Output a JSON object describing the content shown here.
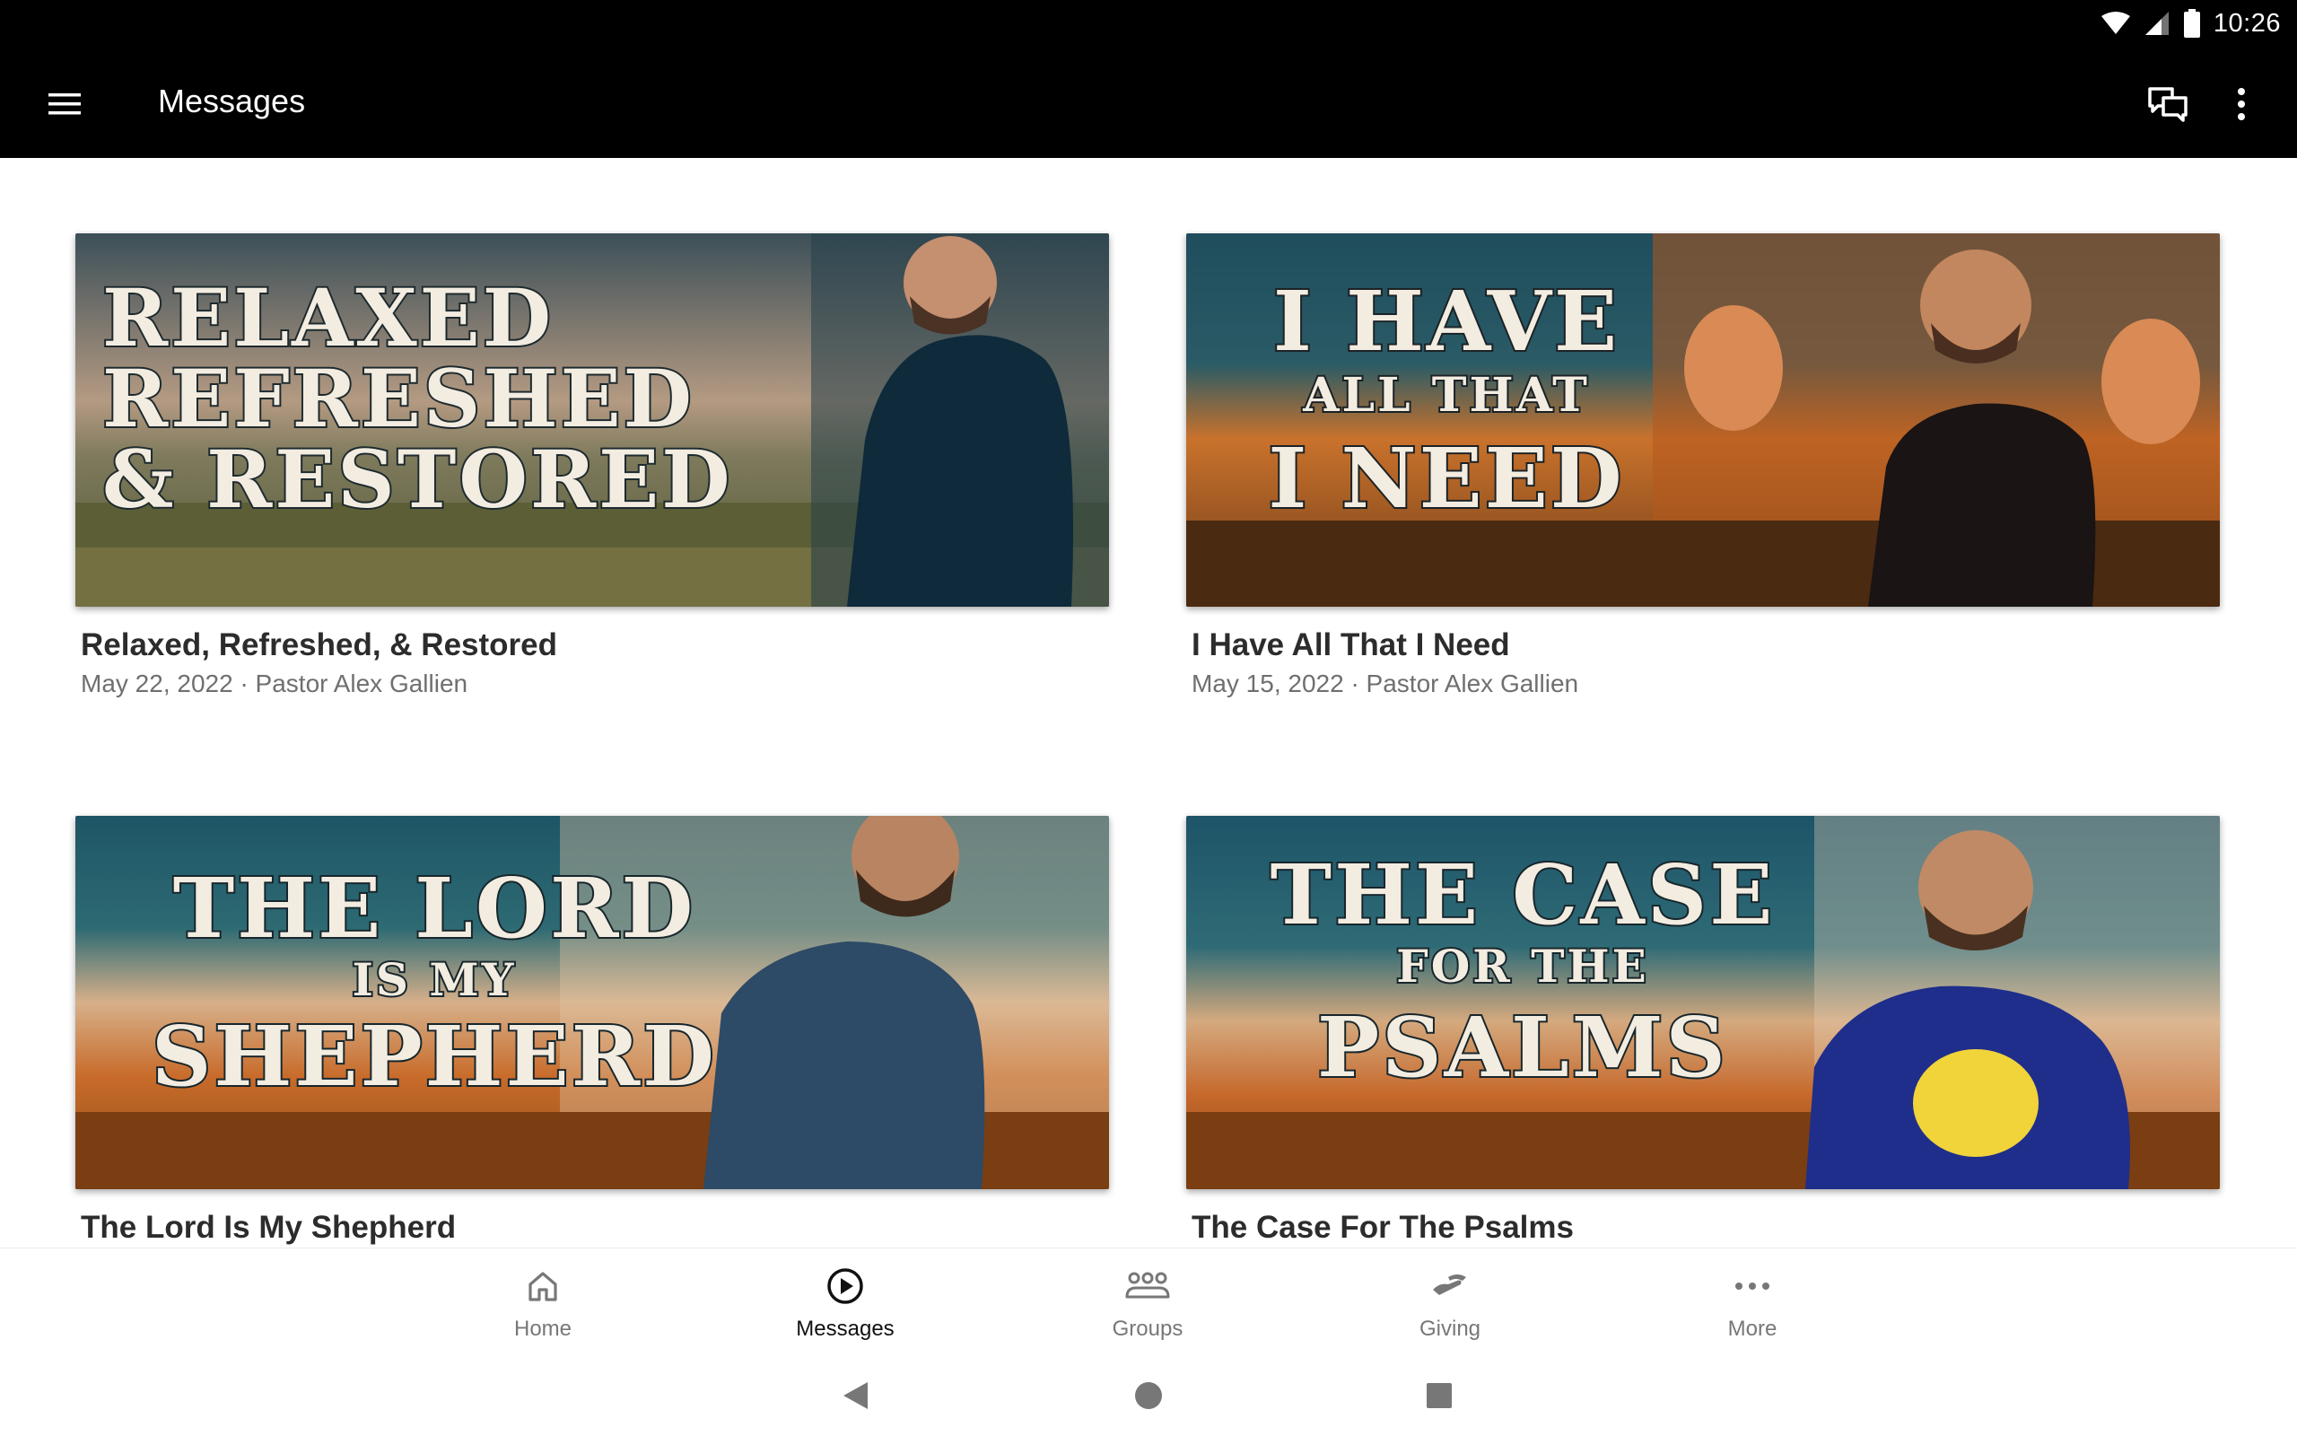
{
  "status_bar": {
    "time": "10:26"
  },
  "toolbar": {
    "title": "Messages"
  },
  "messages": [
    {
      "title": "Relaxed, Refreshed, & Restored",
      "meta": "May 22, 2022 · Pastor Alex Gallien",
      "art_lines": [
        "RELAXED",
        "REFRESHED",
        "& RESTORED"
      ]
    },
    {
      "title": "I Have All That I Need",
      "meta": "May 15, 2022 · Pastor Alex Gallien",
      "art_lines": [
        "I HAVE",
        "ALL THAT",
        "I NEED"
      ]
    },
    {
      "title": "The Lord Is My Shepherd",
      "meta": "",
      "art_lines": [
        "THE LORD",
        "IS MY",
        "SHEPHERD"
      ]
    },
    {
      "title": "The Case For The Psalms",
      "meta": "",
      "art_lines": [
        "THE CASE",
        "FOR THE",
        "PSALMS"
      ]
    }
  ],
  "bottom_nav": [
    {
      "label": "Home",
      "icon": "home-icon"
    },
    {
      "label": "Messages",
      "icon": "play-circle-icon",
      "active": true
    },
    {
      "label": "Groups",
      "icon": "groups-icon"
    },
    {
      "label": "Giving",
      "icon": "giving-hand-icon"
    },
    {
      "label": "More",
      "icon": "more-horizontal-icon"
    }
  ]
}
